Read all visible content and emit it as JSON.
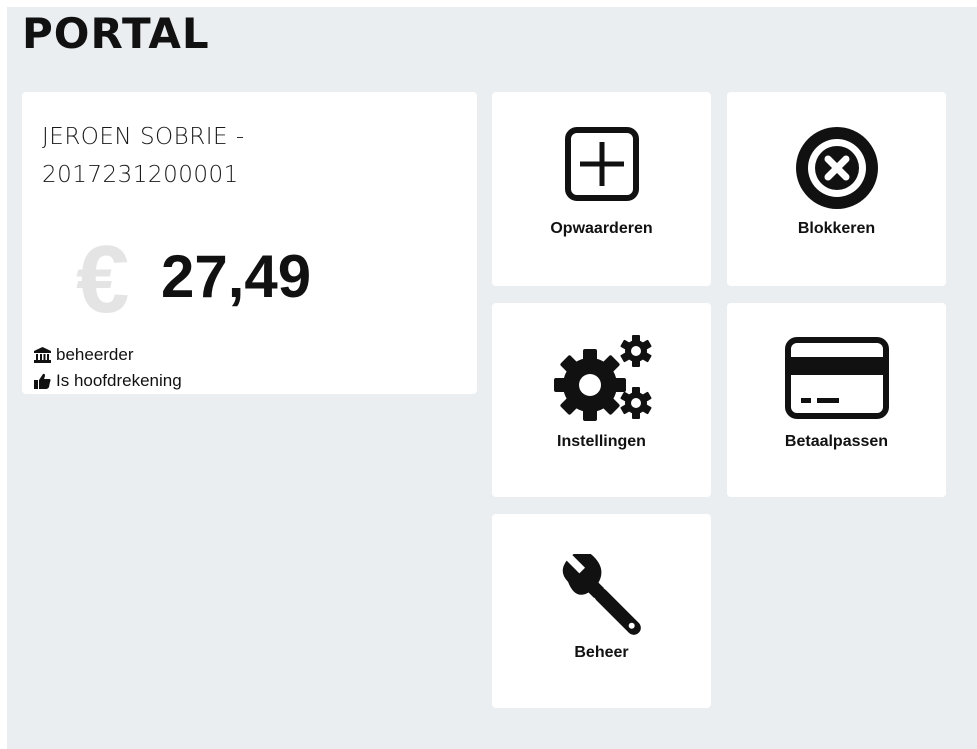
{
  "header": {
    "title": "PORTAL"
  },
  "account": {
    "name": "JEROEN SOBRIE - 2017231200001",
    "currency_symbol": "€",
    "balance": "27,49",
    "role": "beheerder",
    "main_account_note": "Is hoofdrekening"
  },
  "tiles": [
    {
      "label": "Opwaarderen",
      "icon": "plus-square-icon"
    },
    {
      "label": "Blokkeren",
      "icon": "times-circle-icon"
    },
    {
      "label": "Instellingen",
      "icon": "gears-icon"
    },
    {
      "label": "Betaalpassen",
      "icon": "credit-card-icon"
    },
    {
      "label": "Beheer",
      "icon": "wrench-icon"
    }
  ]
}
